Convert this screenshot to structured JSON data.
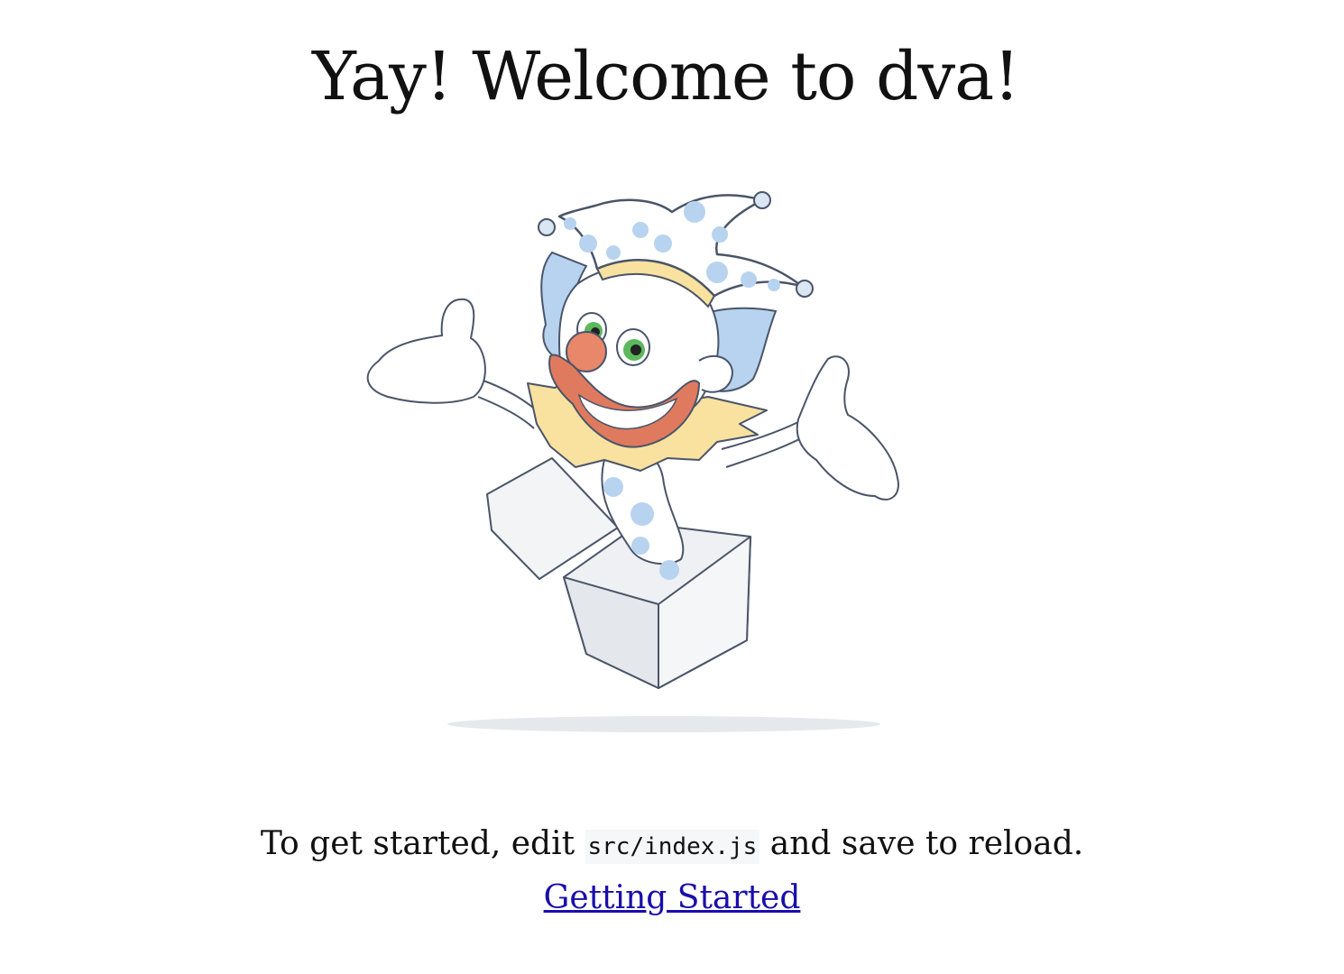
{
  "page": {
    "title": "Yay! Welcome to dva!",
    "caption_before": "To get started, edit ",
    "caption_code": "src/index.js",
    "caption_after": " and save to reload.",
    "link_label": "Getting Started"
  },
  "illustration": {
    "subject": "jester-in-a-box",
    "colors": {
      "outline": "#4a5568",
      "hat_dots": "#b8d3f0",
      "hair": "#b8d3f0",
      "nose": "#e8876a",
      "mouth": "#e07a5f",
      "collar": "#f9e1a0",
      "eyes": "#5cb85c",
      "box": "#eef0f3",
      "shadow": "#e6e9ec"
    }
  }
}
